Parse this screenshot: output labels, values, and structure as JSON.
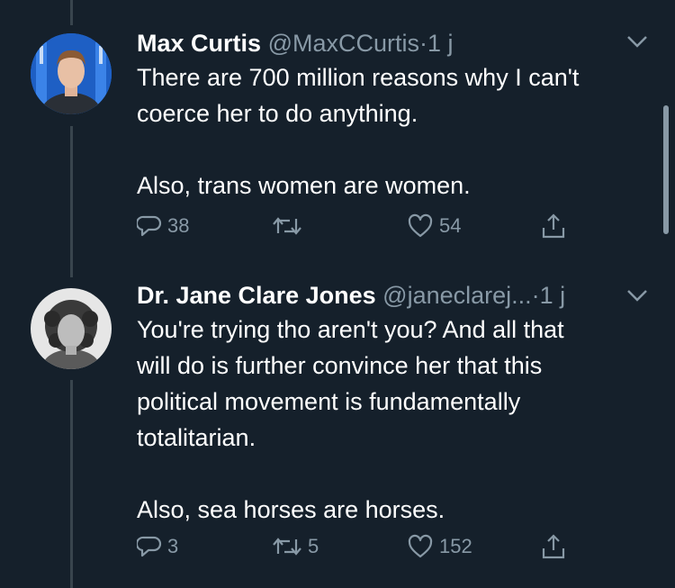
{
  "tweets": [
    {
      "display_name": "Max Curtis",
      "handle": "@MaxCCurtis",
      "separator": "·",
      "time": "1 j",
      "lines": [
        "There are 700 million reasons why I can't",
        "coerce her to do anything.",
        "",
        "Also, trans women are women."
      ],
      "replies": "38",
      "retweets": "",
      "likes": "54"
    },
    {
      "display_name": "Dr. Jane Clare Jones",
      "handle": "@janeclarej...",
      "separator": "·",
      "time": "1 j",
      "lines": [
        "You're trying tho aren't you? And all that",
        "will do is further convince her that this",
        "political movement is fundamentally",
        "totalitarian.",
        "",
        "Also, sea horses are horses."
      ],
      "replies": "3",
      "retweets": "5",
      "likes": "152"
    }
  ],
  "icons": {
    "reply": "speech-bubble-icon",
    "retweet": "retweet-arrows-icon",
    "like": "heart-icon",
    "share": "share-upload-icon",
    "menu": "chevron-down-icon"
  },
  "colors": {
    "background": "#15202b",
    "text": "#ffffff",
    "secondary": "#8899a6",
    "line": "#38444d"
  }
}
